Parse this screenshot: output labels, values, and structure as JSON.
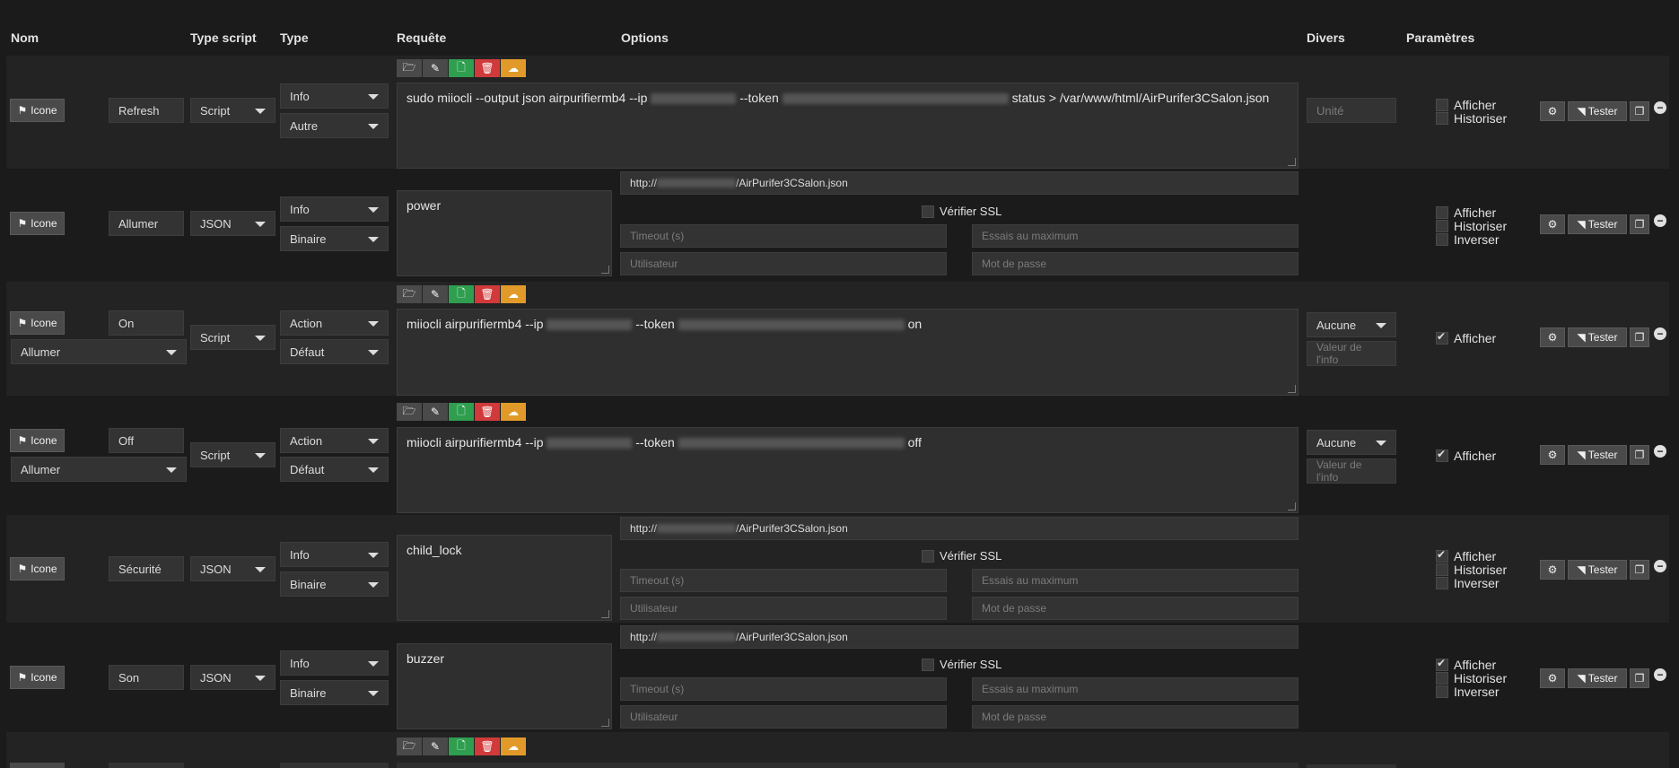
{
  "headers": {
    "nom": "Nom",
    "type_script": "Type script",
    "type": "Type",
    "requete": "Requête",
    "options": "Options",
    "divers": "Divers",
    "parametres": "Paramètres"
  },
  "common": {
    "icone_label": "Icone",
    "tester_label": "Tester",
    "verifier_ssl": "Vérifier SSL",
    "timeout_ph": "Timeout (s)",
    "essais_ph": "Essais au maximum",
    "utilisateur_ph": "Utilisateur",
    "motdepasse_ph": "Mot de passe",
    "unite_ph": "Unité",
    "valeur_info_ph": "Valeur de l'info",
    "afficher": "Afficher",
    "historiser": "Historiser",
    "inverser": "Inverser"
  },
  "rows": [
    {
      "name": "Refresh",
      "script_type": "Script",
      "type": "Info",
      "subtype": "Autre",
      "request_parts": {
        "a": "sudo miiocli --output json airpurifiermb4 --ip",
        "b": "--token",
        "c": "status > /var/www/html/AirPurifer3CSalon.json"
      }
    },
    {
      "name": "Allumer",
      "script_type": "JSON",
      "type": "Info",
      "subtype": "Binaire",
      "request": "power",
      "url_prefix": "http://",
      "url_suffix": "/AirPurifer3CSalon.json"
    },
    {
      "name": "On",
      "linked": "Allumer",
      "script_type": "Script",
      "type": "Action",
      "subtype": "Défaut",
      "request_parts": {
        "a": "miiocli airpurifiermb4 --ip",
        "b": "--token",
        "c": "on"
      },
      "divers_select": "Aucune"
    },
    {
      "name": "Off",
      "linked": "Allumer",
      "script_type": "Script",
      "type": "Action",
      "subtype": "Défaut",
      "request_parts": {
        "a": "miiocli airpurifiermb4 --ip",
        "b": "--token",
        "c": "off"
      },
      "divers_select": "Aucune"
    },
    {
      "name": "Sécurité",
      "script_type": "JSON",
      "type": "Info",
      "subtype": "Binaire",
      "request": "child_lock",
      "url_prefix": "http://",
      "url_suffix": "/AirPurifer3CSalon.json"
    },
    {
      "name": "Son",
      "script_type": "JSON",
      "type": "Info",
      "subtype": "Binaire",
      "request": "buzzer",
      "url_prefix": "http://",
      "url_suffix": "/AirPurifer3CSalon.json"
    }
  ]
}
